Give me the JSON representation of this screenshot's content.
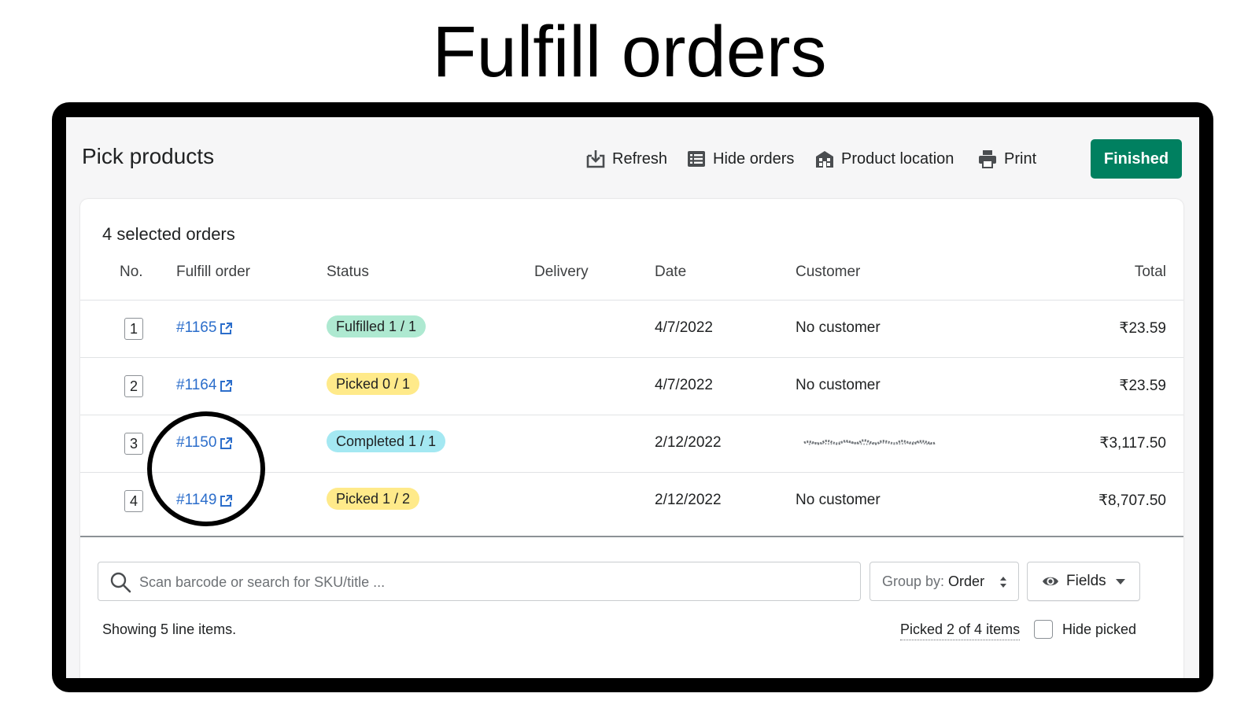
{
  "hero": {
    "title": "Fulfill orders"
  },
  "page": {
    "title": "Pick products"
  },
  "toolbar": {
    "refresh_label": "Refresh",
    "refresh_icon": "download-tray-icon",
    "hide_orders_label": "Hide orders",
    "hide_orders_icon": "list-icon",
    "product_location_label": "Product location",
    "product_location_icon": "building-icon",
    "print_label": "Print",
    "print_icon": "printer-icon",
    "finished_label": "Finished"
  },
  "card": {
    "heading": "4 selected orders"
  },
  "table": {
    "headers": {
      "no": "No.",
      "fulfill_order": "Fulfill order",
      "status": "Status",
      "delivery": "Delivery",
      "date": "Date",
      "customer": "Customer",
      "total": "Total"
    },
    "rows": [
      {
        "no": "1",
        "order": "#1165",
        "status": "Fulfilled 1 / 1",
        "status_color": "#aee9d1",
        "delivery": "",
        "date": "4/7/2022",
        "customer": "No customer",
        "total": "₹23.59"
      },
      {
        "no": "2",
        "order": "#1164",
        "status": "Picked 0 / 1",
        "status_color": "#ffea8a",
        "delivery": "",
        "date": "4/7/2022",
        "customer": "No customer",
        "total": "₹23.59"
      },
      {
        "no": "3",
        "order": "#1150",
        "status": "Completed 1 / 1",
        "status_color": "#a4e8f2",
        "delivery": "",
        "date": "2/12/2022",
        "customer": "",
        "total": "₹3,117.50"
      },
      {
        "no": "4",
        "order": "#1149",
        "status": "Picked 1 / 2",
        "status_color": "#ffea8a",
        "delivery": "",
        "date": "2/12/2022",
        "customer": "No customer",
        "total": "₹8,707.50"
      }
    ]
  },
  "search": {
    "placeholder": "Scan barcode or search for SKU/title ..."
  },
  "group_by": {
    "label": "Group by:",
    "value": "Order"
  },
  "fields": {
    "label": "Fields"
  },
  "footer": {
    "showing": "Showing 5 line items.",
    "picked": "Picked 2 of 4 items",
    "hide_picked": "Hide picked"
  },
  "colors": {
    "primary_green": "#008060",
    "link_blue": "#2c6ecb",
    "badge_green": "#aee9d1",
    "badge_yellow": "#ffea8a",
    "badge_blue": "#a4e8f2"
  }
}
